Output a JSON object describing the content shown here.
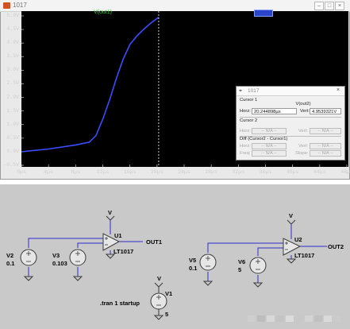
{
  "window": {
    "title": "1017",
    "controls": [
      "minimize",
      "maximize",
      "close"
    ]
  },
  "plot": {
    "trace_label": "V(out1)",
    "y_ticks": [
      "5.0V",
      "4.5V",
      "4.0V",
      "3.5V",
      "3.0V",
      "2.5V",
      "2.0V",
      "1.5V",
      "1.0V",
      "0.5V",
      "0.0V",
      "-0.5V"
    ],
    "x_ticks": [
      "0µs",
      "4µs",
      "8µs",
      "12µs",
      "16µs",
      "20µs",
      "24µs",
      "28µs",
      "32µs",
      "36µs",
      "40µs",
      "44µs",
      "48µs"
    ],
    "trace_color": "#3b4dff",
    "background": "#000000",
    "cursor_color": "#ffffff"
  },
  "chart_data": {
    "type": "line",
    "title": "",
    "xlabel": "",
    "ylabel": "",
    "xlim": [
      0,
      48
    ],
    "ylim": [
      -0.5,
      5.0
    ],
    "x_unit": "µs",
    "y_unit": "V",
    "grid": false,
    "series": [
      {
        "name": "V(out1)",
        "x": [
          0,
          4,
          8,
          10,
          11,
          12,
          13,
          14,
          15,
          16,
          17,
          18,
          19,
          20.24
        ],
        "y": [
          0.0,
          0.1,
          0.25,
          0.35,
          0.6,
          1.2,
          1.9,
          2.7,
          3.4,
          3.95,
          4.25,
          4.5,
          4.72,
          4.95
        ]
      }
    ],
    "cursor_x": 20.244898
  },
  "cursor_panel": {
    "title": "1017",
    "cursor1_label": "Cursor 1",
    "signal": "V(out2)",
    "horz_label": "Horz:",
    "horz_value": "20.244898µs",
    "vert_label": "Vert:",
    "vert_value": "4.9539321V",
    "cursor2_label": "Cursor 2",
    "cursor2_horz_label": "Horz:",
    "cursor2_horz_value": "-- N/A --",
    "cursor2_vert_label": "Vert:",
    "cursor2_vert_value": "-- N/A --",
    "diff_label": "Diff (Cursor2 - Cursor1)",
    "diff_horz_label": "Horz:",
    "diff_horz_value": "-- N/A --",
    "diff_vert_label": "Vert:",
    "diff_vert_value": "-- N/A --",
    "freq_label": "Freq:",
    "freq_value": "-- N/A --",
    "slope_label": "Slope:",
    "slope_value": "-- N/A --"
  },
  "schematic": {
    "circuit1": {
      "supply_label": "V",
      "opamp_name": "U1",
      "opamp_part": "LT1017",
      "out_label": "OUT1",
      "src_a_name": "V2",
      "src_a_value": "0.1",
      "src_b_name": "V3",
      "src_b_value": "0.103"
    },
    "circuit2": {
      "supply_label": "V",
      "opamp_name": "U2",
      "opamp_part": "LT1017",
      "out_label": "OUT2",
      "src_a_name": "V5",
      "src_a_value": "0.1",
      "src_b_name": "V6",
      "src_b_value": "5"
    },
    "supply": {
      "name": "V1",
      "value": "5",
      "net_label": "V"
    },
    "directive": ".tran 1 startup",
    "wire_color": "#2d2dd0",
    "component_color": "#3a3a3a"
  }
}
